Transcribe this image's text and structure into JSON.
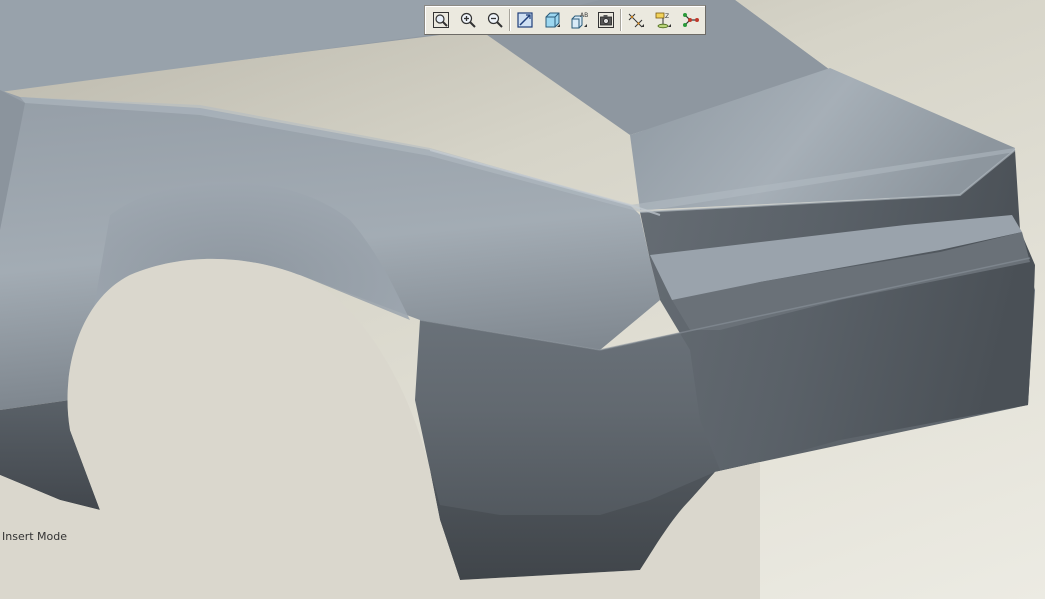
{
  "status": {
    "mode_text": "Insert Mode"
  },
  "toolbar": {
    "buttons": [
      {
        "name": "refit-button",
        "icon": "refit-icon",
        "tooltip_visible": false
      },
      {
        "name": "zoom-in-button",
        "icon": "zoom-in-icon"
      },
      {
        "name": "zoom-out-button",
        "icon": "zoom-out-icon"
      },
      {
        "name": "repaint-button",
        "icon": "repaint-icon"
      },
      {
        "name": "display-style-button",
        "icon": "shaded-cube-icon"
      },
      {
        "name": "saved-views-button",
        "icon": "saved-view-icon"
      },
      {
        "name": "screen-capture-button",
        "icon": "camera-icon"
      },
      {
        "name": "datum-display-button",
        "icon": "datum-axes-icon"
      },
      {
        "name": "annotation-display-button",
        "icon": "annotation-icon"
      },
      {
        "name": "spin-center-button",
        "icon": "spin-center-icon"
      }
    ]
  },
  "colors": {
    "background_top": "#b9b6aa",
    "background_bottom": "#ecebe3",
    "model_light": "#a8b1b9",
    "model_mid": "#7d858d",
    "model_dark": "#4b5056",
    "toolbar_bg": "#ebe9df"
  }
}
